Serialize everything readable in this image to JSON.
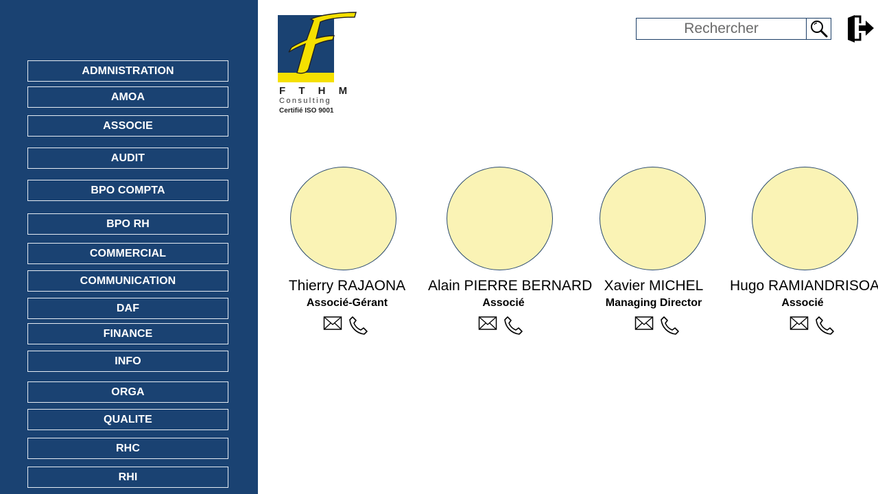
{
  "sidebar": {
    "departments": [
      "ADMNISTRATION",
      "AMOA",
      "ASSOCIE",
      "AUDIT",
      "BPO COMPTA",
      "BPO RH",
      "COMMERCIAL",
      "COMMUNICATION",
      "DAF",
      "FINANCE",
      "INFO",
      "ORGA",
      "QUALITE",
      "RHC",
      "RHI"
    ]
  },
  "logo": {
    "brand": "F T H M",
    "tagline": "Consulting",
    "certification": "Certifié ISO 9001"
  },
  "header": {
    "search_placeholder": "Rechercher",
    "search_icon": "search-icon",
    "logout_icon": "logout-icon"
  },
  "people": [
    {
      "name": "Thierry RAJAONA",
      "role": "Associé-Gérant"
    },
    {
      "name": "Alain PIERRE BERNARD",
      "role": "Associé"
    },
    {
      "name": "Xavier MICHEL",
      "role": "Managing Director"
    },
    {
      "name": "Hugo RAMIANDRISOA",
      "role": "Associé"
    }
  ],
  "colors": {
    "sidebar_bg": "#1a4272",
    "avatar_fill": "#faf3b5",
    "logo_blue": "#1a4272",
    "logo_yellow": "#f5e000"
  }
}
